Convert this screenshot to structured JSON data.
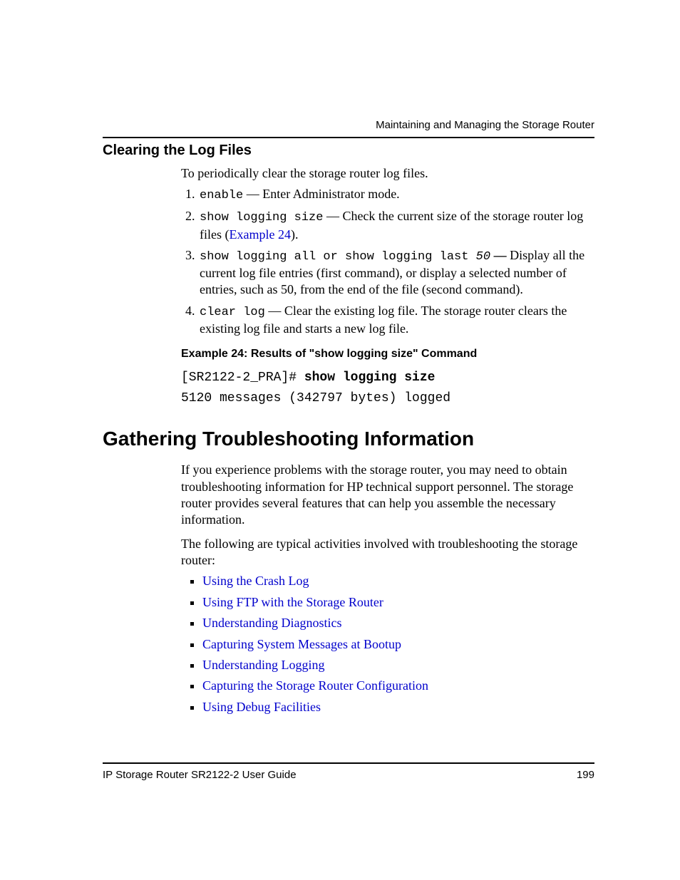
{
  "header": {
    "chapter": "Maintaining and Managing the Storage Router"
  },
  "section1": {
    "title": "Clearing the Log Files",
    "intro": "To periodically clear the storage router log files.",
    "steps": {
      "s1_cmd": "enable",
      "s1_rest": " — Enter Administrator mode.",
      "s2_cmd": "show logging size",
      "s2_mid": " —  Check the current size of the storage router log files (",
      "s2_link": "Example 24",
      "s2_end": ").",
      "s3_cmd": "show logging all or show logging last",
      "s3_arg": " 50",
      "s3_bold": " — ",
      "s3_rest": "Display all the current log file entries (first command), or display a selected number of entries, such as 50, from the end of the file (second command).",
      "s4_cmd": "clear log",
      "s4_rest": " —  Clear the existing log file. The storage router clears the existing log file and starts a new log file."
    }
  },
  "example": {
    "title": "Example 24:  Results of \"show logging size\" Command",
    "line1_prompt": "[SR2122-2_PRA]# ",
    "line1_cmd": "show logging size",
    "line2": "5120 messages (342797 bytes) logged"
  },
  "section2": {
    "title": "Gathering Troubleshooting Information",
    "para1": "If you experience problems with the storage router, you may need to obtain troubleshooting information for HP technical support personnel. The storage router provides several features that can help you assemble the necessary information.",
    "para2": "The following are typical activities involved with troubleshooting the storage router:",
    "links": [
      "Using the Crash Log",
      "Using FTP with the Storage Router",
      "Understanding Diagnostics",
      "Capturing System Messages at Bootup",
      "Understanding Logging",
      "Capturing the Storage Router Configuration",
      "Using Debug Facilities"
    ]
  },
  "footer": {
    "guide": "IP Storage Router SR2122-2 User Guide",
    "page": "199"
  }
}
